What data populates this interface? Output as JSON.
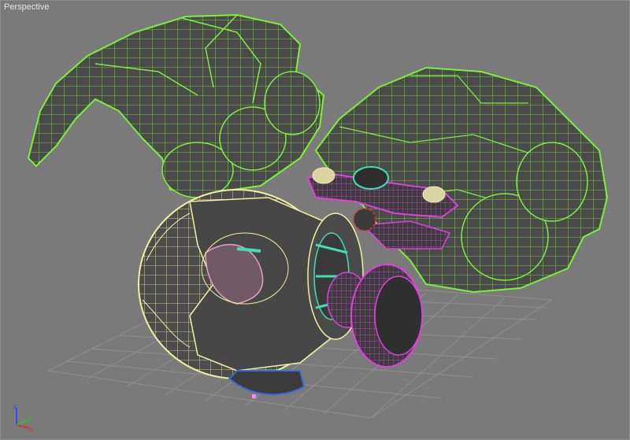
{
  "viewport": {
    "label": "Perspective"
  },
  "gizmo": {
    "axis_x": "x",
    "axis_y": "y",
    "axis_z": "z",
    "color_x": "#e03030",
    "color_y": "#30c030",
    "color_z": "#3050e0"
  },
  "colors": {
    "background": "#7a7a7a",
    "grid": "#8e8e8e",
    "mesh_fill": "#4a4a4a",
    "wire_green": "#7cf03c",
    "wire_yellow": "#f4f0a0",
    "wire_magenta": "#e040e0",
    "wire_cyan": "#40e0b0",
    "wire_blue": "#3a6ae0"
  }
}
